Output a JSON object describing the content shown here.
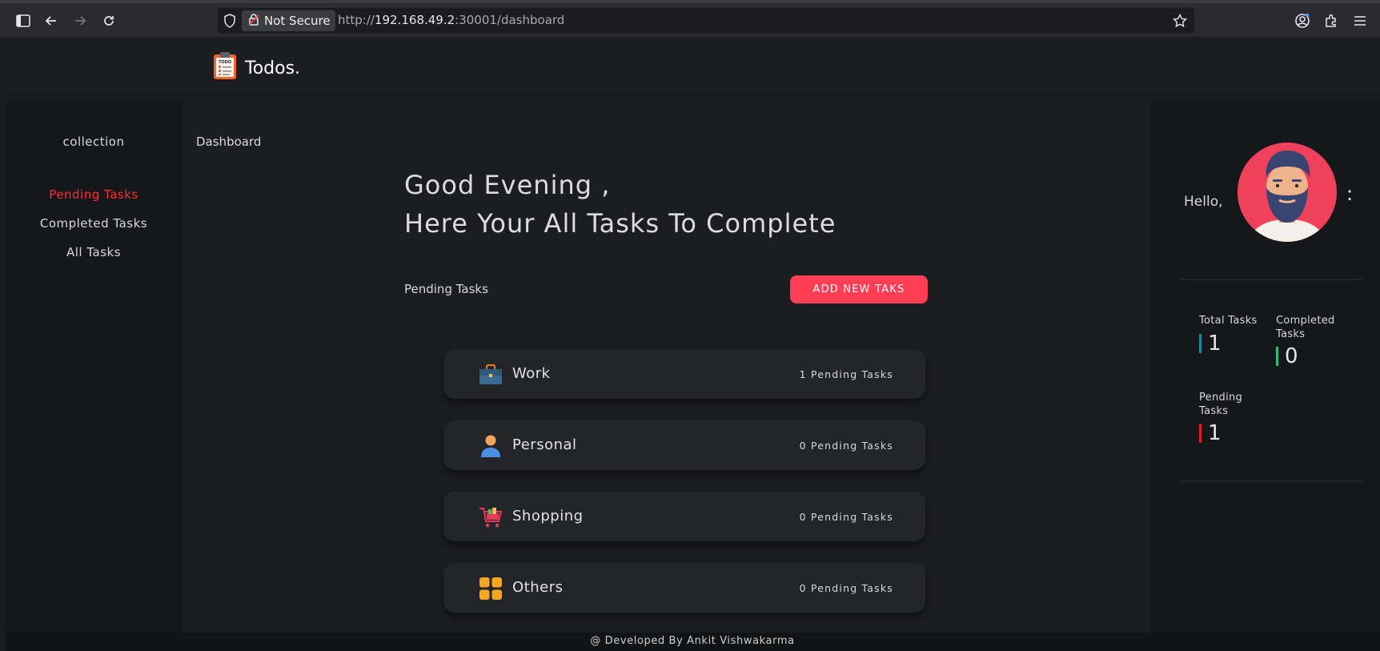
{
  "browser": {
    "not_secure": "Not Secure",
    "url_prefix": "http://",
    "url_host": "192.168.49.2",
    "url_rest": ":30001/dashboard"
  },
  "app": {
    "brand": "Todos."
  },
  "sidebar": {
    "heading": "collection",
    "items": [
      {
        "label": "Pending Tasks",
        "active": true
      },
      {
        "label": "Completed Tasks",
        "active": false
      },
      {
        "label": "All Tasks",
        "active": false
      }
    ]
  },
  "main": {
    "breadcrumb": "Dashboard",
    "greeting_line1": "Good Evening ,",
    "greeting_line2": "Here Your All Tasks To Complete",
    "section_label": "Pending Tasks",
    "add_button": "ADD NEW TAKS",
    "categories": [
      {
        "name": "Work",
        "count": "1 Pending Tasks",
        "icon": "briefcase-icon"
      },
      {
        "name": "Personal",
        "count": "0 Pending Tasks",
        "icon": "person-icon"
      },
      {
        "name": "Shopping",
        "count": "0 Pending Tasks",
        "icon": "shopping-cart-icon"
      },
      {
        "name": "Others",
        "count": "0 Pending Tasks",
        "icon": "grid-icon"
      }
    ]
  },
  "profile": {
    "hello": "Hello,",
    "menu": ":",
    "stats": {
      "total_label": "Total Tasks",
      "total_value": "1",
      "completed_label": "Completed Tasks",
      "completed_value": "0",
      "pending_label": "Pending Tasks",
      "pending_value": "1"
    },
    "colors": {
      "total": "#1b8a9a",
      "completed": "#2fbf71",
      "pending": "#e01b24"
    }
  },
  "footer": {
    "text": "@ Developed By Ankit Vishwakarma"
  },
  "colors": {
    "accent": "#ff3d55",
    "active_nav": "#ff2d2d"
  }
}
